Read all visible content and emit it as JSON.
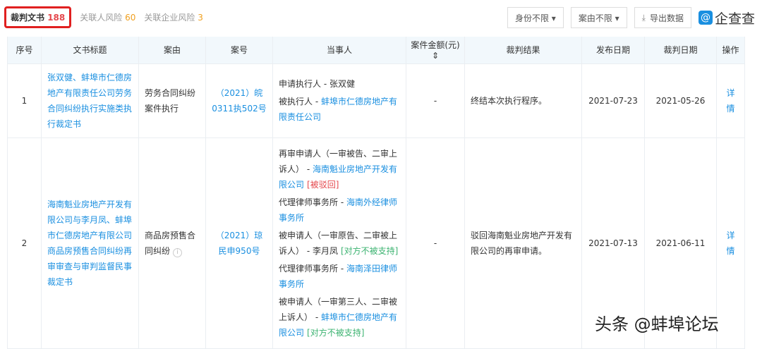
{
  "tabs": [
    {
      "label": "裁判文书",
      "count": "188"
    },
    {
      "label": "关联人风险",
      "count": "60"
    },
    {
      "label": "关联企业风险",
      "count": "3"
    }
  ],
  "toolbar": {
    "identity": "身份不限 ▾",
    "cause": "案由不限 ▾",
    "export": "导出数据",
    "logo": "企查查"
  },
  "headers": [
    "序号",
    "文书标题",
    "案由",
    "案号",
    "当事人",
    "案件金额(元) ⇕",
    "裁判结果",
    "发布日期",
    "裁判日期",
    "操作"
  ],
  "rows": [
    {
      "no": "1",
      "title": "张双健、蚌埠市仁德房地产有限责任公司劳务合同纠纷执行实施类执行裁定书",
      "cause": "劳务合同纠纷案件执行",
      "case_no": "（2021）皖0311执502号",
      "parties": [
        {
          "role": "申请执行人 - ",
          "name": "张双健",
          "name_link": false
        },
        {
          "role": "被执行人 - ",
          "name": "蚌埠市仁德房地产有限责任公司",
          "name_link": true
        }
      ],
      "amount": "-",
      "result": "终结本次执行程序。",
      "publish": "2021-07-23",
      "judge": "2021-05-26",
      "action": "详情"
    },
    {
      "no": "2",
      "title": "海南魁业房地产开发有限公司与李月凤、蚌埠市仁德房地产有限公司商品房预售合同纠纷再审审查与审判监督民事裁定书",
      "cause": "商品房预售合同纠纷",
      "case_no": "（2021）琼民申950号",
      "parties": [
        {
          "role": "再审申请人（一审被告、二审上诉人） - ",
          "name": "海南魁业房地产开发有限公司",
          "name_link": true,
          "tag": "[被驳回]",
          "tag_color": "red"
        },
        {
          "role": "代理律师事务所 - ",
          "name": "海南外经律师事务所",
          "name_link": true
        },
        {
          "role": "被申请人（一审原告、二审被上诉人） - ",
          "name": "李月凤",
          "name_link": false,
          "tag": "[对方不被支持]",
          "tag_color": "green"
        },
        {
          "role": "代理律师事务所 - ",
          "name": "海南泽田律师事务所",
          "name_link": true
        },
        {
          "role": "被申请人（一审第三人、二审被上诉人） - ",
          "name": "蚌埠市仁德房地产有限公司",
          "name_link": true,
          "tag": "[对方不被支持]",
          "tag_color": "green"
        }
      ],
      "amount": "-",
      "result": "驳回海南魁业房地产开发有限公司的再审申请。",
      "publish": "2021-07-13",
      "judge": "2021-06-11",
      "action": "详情"
    }
  ],
  "watermark": "头条 @蚌埠论坛"
}
